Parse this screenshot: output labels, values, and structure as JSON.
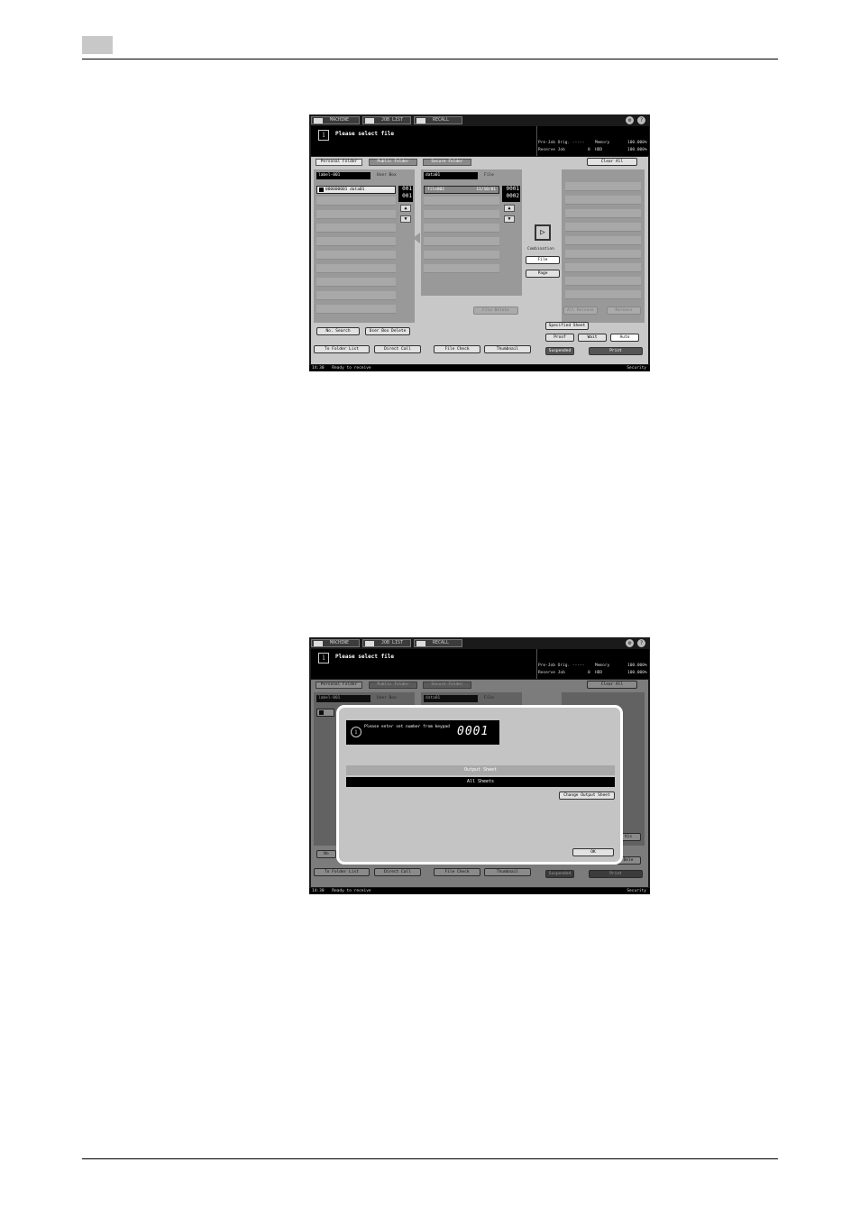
{
  "ui": {
    "tabs": [
      "MACHINE",
      "JOB LIST",
      "RECALL"
    ],
    "right_icons": [
      "settings-icon",
      "help-icon"
    ],
    "message": "Please select file",
    "status": {
      "pre_job": "Pre-Job Orig. -----",
      "memory_label": "Memory",
      "memory_value": "100.000%",
      "reserve": "Reserve Job",
      "reserve_count": "0",
      "hdd_label": "HDD",
      "hdd_value": "100.000%"
    },
    "folder_tabs": [
      "Personal Folder",
      "Public Folder",
      "Secure Folder"
    ],
    "clear_all": "Clear All",
    "user_box": {
      "name": "label-001",
      "label": "User Box",
      "item": "000000001 data01",
      "count_top": "001",
      "count_bottom": "001"
    },
    "file_box": {
      "name": "data01",
      "label": "File",
      "item_name": "file002",
      "item_date": "11/10/01",
      "count_top": "0001",
      "count_bottom": "0002"
    },
    "combination_label": "Combination",
    "combo_file": "File",
    "combo_page": "Page",
    "file_delete": "File Delete",
    "all_release": "All Release",
    "release": "Release",
    "no_search": "No. Search",
    "user_box_delete": "User Box Delete",
    "output_sheet_btn": "Specified Sheet",
    "proof": "Proof",
    "wait": "Wait",
    "auto": "Auto",
    "to_folder_list": "To Folder List",
    "direct_call": "Direct Call",
    "file_check": "File Check",
    "thumbnail": "Thumbnail",
    "suspended": "Suspended",
    "print": "Print",
    "statusbar_time": "14:30",
    "statusbar_text": "Ready to receive",
    "security": "Security"
  },
  "dialog": {
    "prompt": "Please enter set number from keypad",
    "set_number": "0001",
    "output_sheet_header": "Output Sheet",
    "output_sheet_value": "All Sheets",
    "change_button": "Change Output Sheet",
    "ok_button": "OK",
    "bg_partial_1": "No",
    "bg_partial_2": "Dele",
    "bg_partial_3": "Vis"
  }
}
